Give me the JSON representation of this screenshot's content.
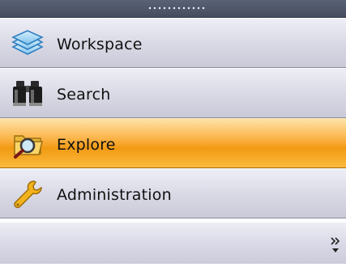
{
  "nav": {
    "items": [
      {
        "label": "Workspace",
        "icon": "layers-icon",
        "active": false
      },
      {
        "label": "Search",
        "icon": "binoculars-icon",
        "active": false
      },
      {
        "label": "Explore",
        "icon": "folder-magnifier-icon",
        "active": true
      },
      {
        "label": "Administration",
        "icon": "wrench-icon",
        "active": false
      }
    ]
  },
  "colors": {
    "active_top": "#fde3a8",
    "active_mid": "#f29a14",
    "item_top": "#eeeef6",
    "item_bottom": "#c9c9d8",
    "grip": "#4f566a"
  },
  "footer": {
    "overflow_icon": "chevron-double-right-icon"
  }
}
